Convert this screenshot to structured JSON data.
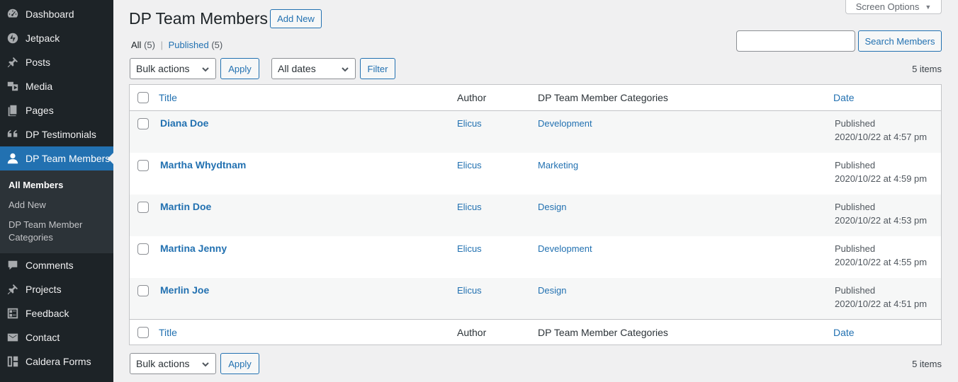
{
  "sidebar": {
    "items": [
      {
        "label": "Dashboard",
        "icon": "dashboard-icon"
      },
      {
        "label": "Jetpack",
        "icon": "jetpack-icon"
      },
      {
        "label": "Posts",
        "icon": "pin-icon"
      },
      {
        "label": "Media",
        "icon": "media-icon"
      },
      {
        "label": "Pages",
        "icon": "pages-icon"
      },
      {
        "label": "DP Testimonials",
        "icon": "quote-icon"
      },
      {
        "label": "DP Team Members",
        "icon": "user-icon"
      },
      {
        "label": "Comments",
        "icon": "comment-icon"
      },
      {
        "label": "Projects",
        "icon": "pin-icon"
      },
      {
        "label": "Feedback",
        "icon": "feedback-icon"
      },
      {
        "label": "Contact",
        "icon": "mail-icon"
      },
      {
        "label": "Caldera Forms",
        "icon": "caldera-icon"
      }
    ],
    "submenu": [
      "All Members",
      "Add New",
      "DP Team Member",
      "Categories"
    ]
  },
  "header": {
    "title": "DP Team Members",
    "add_new": "Add New",
    "screen_options": "Screen Options"
  },
  "views": {
    "all_label": "All",
    "all_count": "(5)",
    "separator": "|",
    "published_label": "Published",
    "published_count": "(5)"
  },
  "search": {
    "value": "",
    "button": "Search Members"
  },
  "controls": {
    "bulk_actions": "Bulk actions",
    "apply": "Apply",
    "dates": "All dates",
    "filter": "Filter",
    "items_count": "5 items"
  },
  "table": {
    "columns": {
      "title": "Title",
      "author": "Author",
      "categories": "DP Team Member Categories",
      "date": "Date"
    },
    "rows": [
      {
        "title": "Diana Doe",
        "author": "Elicus",
        "category": "Development",
        "status": "Published",
        "date": "2020/10/22 at 4:57 pm"
      },
      {
        "title": "Martha Whydtnam",
        "author": "Elicus",
        "category": "Marketing",
        "status": "Published",
        "date": "2020/10/22 at 4:59 pm"
      },
      {
        "title": "Martin Doe",
        "author": "Elicus",
        "category": "Design",
        "status": "Published",
        "date": "2020/10/22 at 4:53 pm"
      },
      {
        "title": "Martina Jenny",
        "author": "Elicus",
        "category": "Development",
        "status": "Published",
        "date": "2020/10/22 at 4:55 pm"
      },
      {
        "title": "Merlin Joe",
        "author": "Elicus",
        "category": "Design",
        "status": "Published",
        "date": "2020/10/22 at 4:51 pm"
      }
    ]
  },
  "colors": {
    "accent": "#2271b1",
    "sidebar": "#1d2327",
    "background": "#f0f0f1"
  }
}
